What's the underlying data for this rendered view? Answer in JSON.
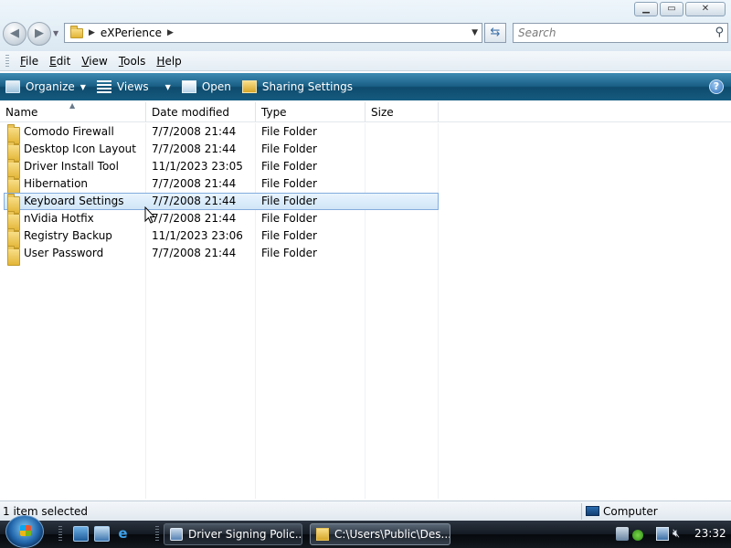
{
  "window": {
    "buttons": [
      "minimize",
      "maximize",
      "close"
    ]
  },
  "address_bar": {
    "path": "eXPerience"
  },
  "search": {
    "placeholder": "Search"
  },
  "menu": {
    "items": [
      {
        "label": "File",
        "key": "F",
        "rest": "ile"
      },
      {
        "label": "Edit",
        "key": "E",
        "rest": "dit"
      },
      {
        "label": "View",
        "key": "V",
        "rest": "iew"
      },
      {
        "label": "Tools",
        "key": "T",
        "rest": "ools"
      },
      {
        "label": "Help",
        "key": "H",
        "rest": "elp"
      }
    ]
  },
  "command_bar": {
    "organize": "Organize",
    "views": "Views",
    "open": "Open",
    "sharing": "Sharing Settings",
    "help": "?"
  },
  "columns": {
    "name": "Name",
    "date": "Date modified",
    "type": "Type",
    "size": "Size"
  },
  "files": [
    {
      "name": "Comodo Firewall",
      "date": "7/7/2008 21:44",
      "type": "File Folder",
      "selected": false
    },
    {
      "name": "Desktop Icon Layout",
      "date": "7/7/2008 21:44",
      "type": "File Folder",
      "selected": false
    },
    {
      "name": "Driver Install Tool",
      "date": "11/1/2023 23:05",
      "type": "File Folder",
      "selected": false
    },
    {
      "name": "Hibernation",
      "date": "7/7/2008 21:44",
      "type": "File Folder",
      "selected": false
    },
    {
      "name": "Keyboard Settings",
      "date": "7/7/2008 21:44",
      "type": "File Folder",
      "selected": true
    },
    {
      "name": "nVidia Hotfix",
      "date": "7/7/2008 21:44",
      "type": "File Folder",
      "selected": false
    },
    {
      "name": "Registry Backup",
      "date": "11/1/2023 23:06",
      "type": "File Folder",
      "selected": false
    },
    {
      "name": "User Password",
      "date": "7/7/2008 21:44",
      "type": "File Folder",
      "selected": false
    }
  ],
  "status": {
    "selection": "1 item selected",
    "location": "Computer"
  },
  "taskbar": {
    "tasks": [
      {
        "label": "Driver Signing Polic...",
        "icon": "driver-signing-icon"
      },
      {
        "label": "C:\\Users\\Public\\Des...",
        "icon": "folder-icon"
      }
    ],
    "clock": "23:32"
  }
}
